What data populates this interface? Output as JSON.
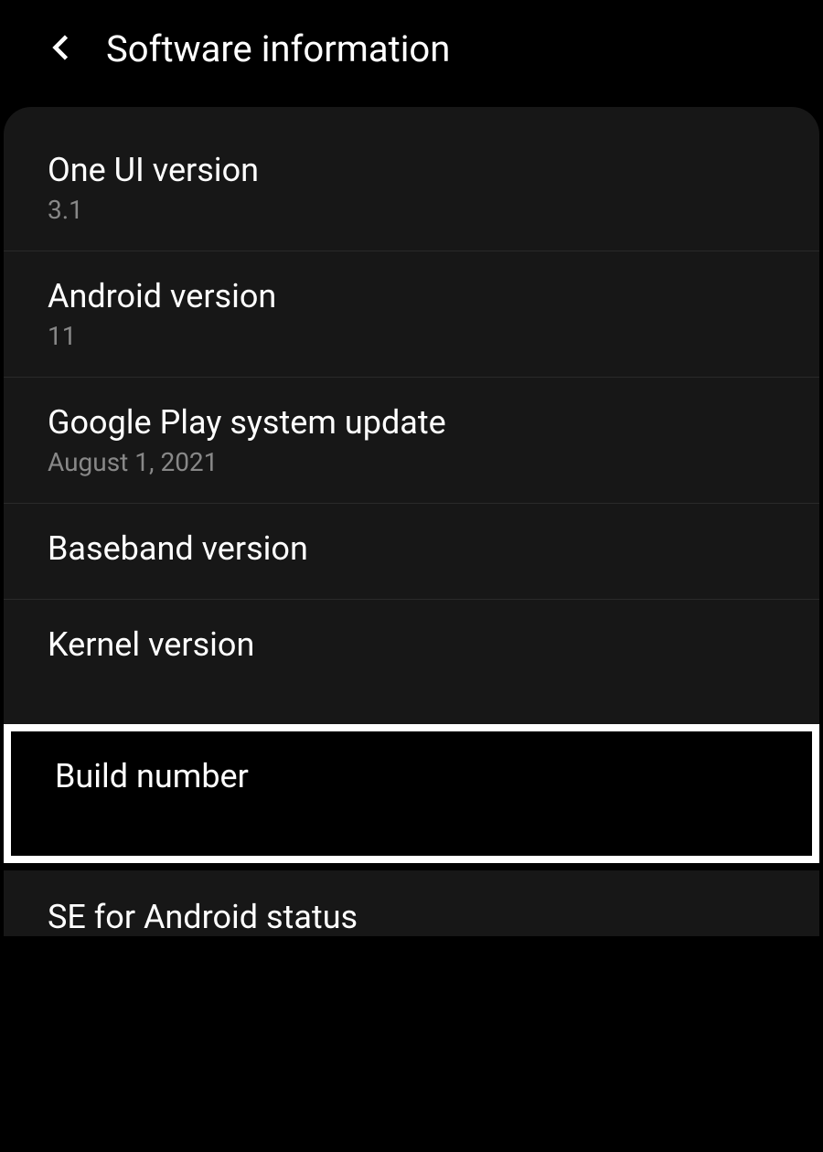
{
  "header": {
    "title": "Software information"
  },
  "items": [
    {
      "title": "One UI version",
      "value": "3.1"
    },
    {
      "title": "Android version",
      "value": "11"
    },
    {
      "title": "Google Play system update",
      "value": "August 1, 2021"
    },
    {
      "title": "Baseband version",
      "value": ""
    },
    {
      "title": "Kernel version",
      "value": ""
    }
  ],
  "highlighted": {
    "title": "Build number"
  },
  "bottom": {
    "title": "SE for Android status"
  }
}
